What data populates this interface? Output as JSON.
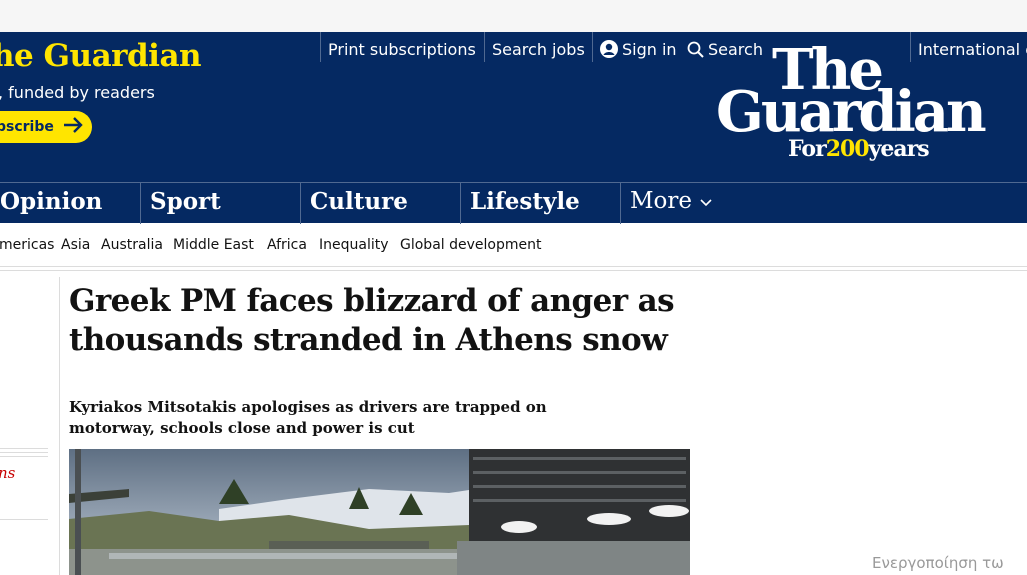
{
  "support": {
    "title": "he Guardian",
    "subtitle": ", funded by readers",
    "subscribe_label": "bscribe"
  },
  "toplinks": {
    "print_subscriptions": "Print subscriptions",
    "search_jobs": "Search jobs",
    "sign_in": "Sign in",
    "search": "Search",
    "edition": "International e"
  },
  "logo": {
    "line1": "The",
    "line2": "Guardian",
    "tag_for": "For",
    "tag_number": "200",
    "tag_years": "years"
  },
  "nav": {
    "pillars": [
      "Opinion",
      "Sport",
      "Culture",
      "Lifestyle"
    ],
    "more": "More"
  },
  "subnav": {
    "items": [
      "mericas",
      "Asia",
      "Australia",
      "Middle East",
      "Africa",
      "Inequality",
      "Global development"
    ]
  },
  "sidebar": {
    "red_text": "ns"
  },
  "article": {
    "headline": "Greek PM faces blizzard of anger as thousands stranded in Athens snow",
    "standfirst": "Kyriakos Mitsotakis apologises as drivers are trapped on motorway, schools close and power is cut"
  },
  "os": {
    "activation_text": "Ενεργοποίηση τω"
  },
  "colors": {
    "brand_blue": "#052962",
    "brand_yellow": "#ffe500",
    "sidebar_red": "#c70000"
  }
}
